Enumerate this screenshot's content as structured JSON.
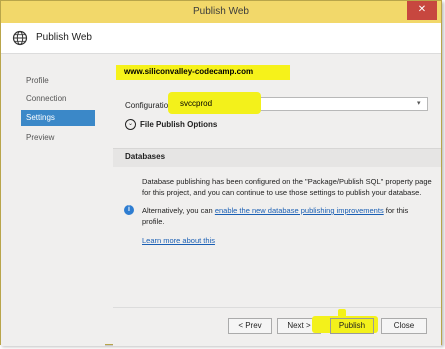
{
  "window": {
    "title": "Publish Web",
    "close_glyph": "✕"
  },
  "header": {
    "title": "Publish Web",
    "icon": "globe-icon"
  },
  "nav": {
    "items": [
      {
        "label": "Profile"
      },
      {
        "label": "Connection"
      },
      {
        "label": "Settings"
      },
      {
        "label": "Preview"
      }
    ],
    "active_index": 2
  },
  "content": {
    "url": "www.siliconvalley-codecamp.com",
    "configuration_label": "Configuration:",
    "configuration_value": "svccprod",
    "file_publish_options": "File Publish Options",
    "databases_heading": "Databases",
    "db_paragraph": "Database publishing has been configured on the \"Package/Publish SQL\" property page for this project, and you can continue to use those settings to publish your database.",
    "alt_prefix": "Alternatively, you can ",
    "alt_link": "enable the new database publishing improvements",
    "alt_suffix": " for this profile.",
    "learn_more": "Learn more about this"
  },
  "buttons": {
    "prev": "< Prev",
    "next": "Next >",
    "publish": "Publish",
    "close": "Close"
  },
  "colors": {
    "highlight": "#f3f11b",
    "title_bar": "#f2d86a",
    "accent": "#3b88c8",
    "link": "#1a5fb4"
  }
}
